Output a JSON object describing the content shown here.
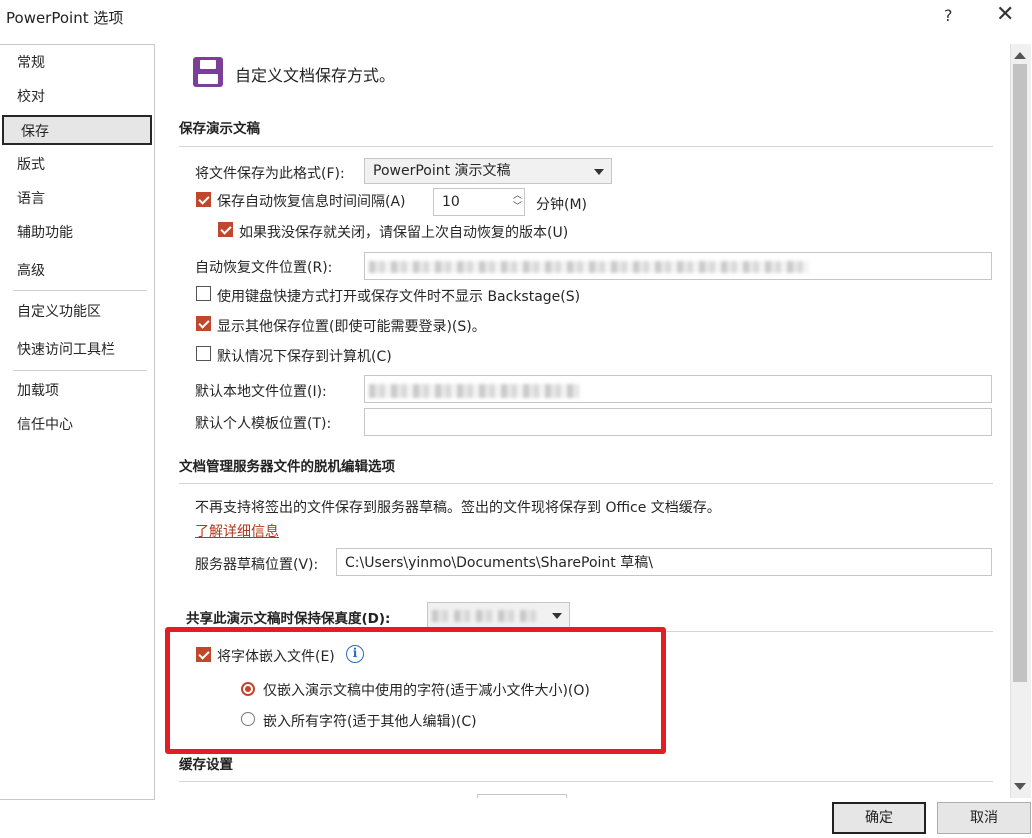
{
  "window": {
    "title": "PowerPoint 选项",
    "help": "?",
    "close": "✕"
  },
  "sidebar": {
    "items": [
      {
        "label": "常规"
      },
      {
        "label": "校对"
      },
      {
        "label": "保存"
      },
      {
        "label": "版式"
      },
      {
        "label": "语言"
      },
      {
        "label": "辅助功能"
      },
      {
        "label": "高级"
      },
      {
        "label": "自定义功能区"
      },
      {
        "label": "快速访问工具栏"
      },
      {
        "label": "加载项"
      },
      {
        "label": "信任中心"
      }
    ],
    "selected": "保存"
  },
  "header": {
    "title": "自定义文档保存方式。",
    "icon": "save-icon"
  },
  "save_section": {
    "title": "保存演示文稿",
    "format_label": "将文件保存为此格式(F):",
    "format_value": "PowerPoint 演示文稿",
    "autorecover_label": "保存自动恢复信息时间间隔(A)",
    "autorecover_checked": true,
    "autorecover_minutes": "10",
    "minutes_label": "分钟(M)",
    "keep_last_label": "如果我没保存就关闭，请保留上次自动恢复的版本(U)",
    "keep_last_checked": true,
    "autorecover_location_label": "自动恢复文件位置(R):",
    "keyboard_backstage_label": "使用键盘快捷方式打开或保存文件时不显示 Backstage(S)",
    "keyboard_backstage_checked": false,
    "show_other_locations_label": "显示其他保存位置(即使可能需要登录)(S)。",
    "show_other_locations_checked": true,
    "save_to_computer_label": "默认情况下保存到计算机(C)",
    "save_to_computer_checked": false,
    "local_location_label": "默认本地文件位置(I):",
    "template_location_label": "默认个人模板位置(T):"
  },
  "offline_section": {
    "title": "文档管理服务器文件的脱机编辑选项",
    "notice": "不再支持将签出的文件保存到服务器草稿。签出的文件现将保存到 Office 文档缓存。",
    "learn_more": "了解详细信息",
    "drafts_label": "服务器草稿位置(V):",
    "drafts_value": "C:\\Users\\yinmo\\Documents\\SharePoint 草稿\\"
  },
  "fidelity_section": {
    "title": "共享此演示文稿时保持保真度(D):",
    "embed_fonts_label": "将字体嵌入文件(E)",
    "embed_fonts_checked": true,
    "embed_used_label": "仅嵌入演示文稿中使用的字符(适于减小文件大小)(O)",
    "embed_all_label": "嵌入所有字符(适于其他人编辑)(C)",
    "selected_option": "embed_used"
  },
  "cache_section": {
    "title": "缓存设置"
  },
  "footer": {
    "ok": "确定",
    "cancel": "取消"
  },
  "colors": {
    "accent": "#c0472b",
    "highlight": "#e51c23",
    "save_icon": "#7b3f98"
  }
}
